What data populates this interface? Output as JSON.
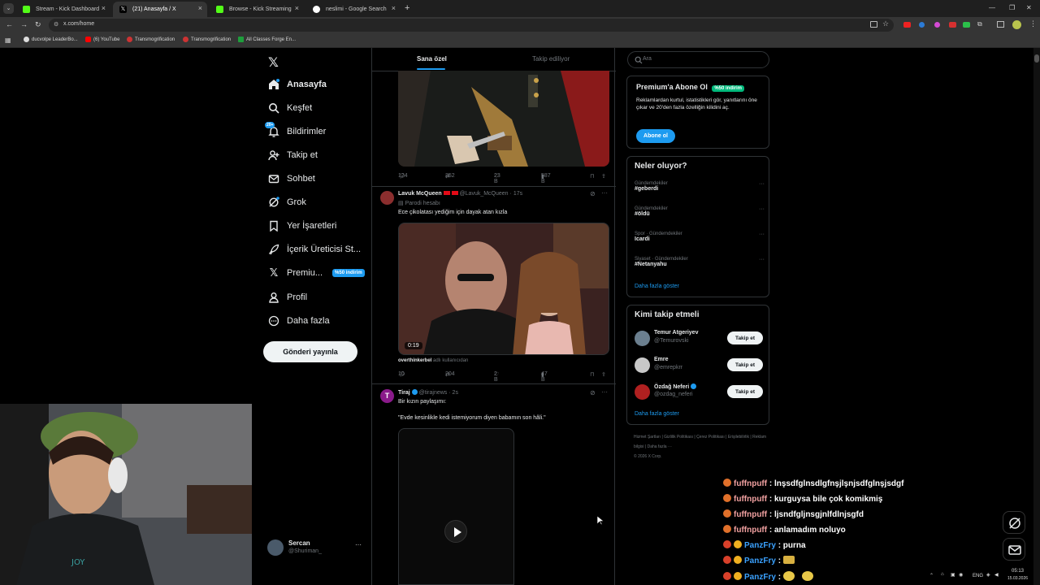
{
  "browser": {
    "tabs": [
      {
        "label": "Stream - Kick Dashboard",
        "active": false,
        "color": "#53fc18"
      },
      {
        "label": "(21) Anasayfa / X",
        "active": true,
        "color": "#ffffff"
      },
      {
        "label": "Browse - Kick Streaming",
        "active": false,
        "color": "#53fc18"
      },
      {
        "label": "neslimi - Google Search",
        "active": false,
        "color": "#4285f4"
      }
    ],
    "url": "x.com/home",
    "bookmarks": [
      "ducvolpe LeaderBo...",
      "(6) YouTube",
      "Transmogrification",
      "Transmogrification",
      "All Classes Forge En..."
    ],
    "window_controls": [
      "—",
      "❐",
      "✕"
    ]
  },
  "sidebar": {
    "items": [
      {
        "label": "Anasayfa",
        "icon": "home-icon"
      },
      {
        "label": "Keşfet",
        "icon": "search-icon"
      },
      {
        "label": "Bildirimler",
        "icon": "bell-icon",
        "badge": "20+"
      },
      {
        "label": "Takip et",
        "icon": "add-user-icon"
      },
      {
        "label": "Sohbet",
        "icon": "mail-icon"
      },
      {
        "label": "Grok",
        "icon": "grok-icon"
      },
      {
        "label": "Yer İşaretleri",
        "icon": "bookmark-icon"
      },
      {
        "label": "İçerik Üreticisi St...",
        "icon": "rocket-icon"
      },
      {
        "label": "Premiu...",
        "icon": "x-icon",
        "badge": "%50 indirim"
      },
      {
        "label": "Profil",
        "icon": "profile-icon"
      },
      {
        "label": "Daha fazla",
        "icon": "more-circle-icon"
      }
    ],
    "post_button": "Gönderi yayınla",
    "account": {
      "name": "Sercan",
      "handle": "@Shuriman_"
    }
  },
  "feed": {
    "tabs": [
      "Sana özel",
      "Takip ediliyor"
    ],
    "post1_actions": {
      "replies": "124",
      "reposts": "352",
      "likes": "23 B",
      "views": "587 B"
    },
    "post2": {
      "author": "Lavuk McQueen",
      "handle": "@Lavuk_McQueen",
      "time": "17s",
      "parody": "Parodi hesabı",
      "text": "Ece çikolatası yediğim için dayak atan kızla",
      "video_time": "0:19",
      "source_user": "overthinkerbel",
      "source_suffix": "adlı kullanıcıdan",
      "replies": "10",
      "reposts": "204",
      "likes": "2 B",
      "views": "47 B"
    },
    "post3": {
      "author": "Tiraj",
      "handle": "@tirajnews",
      "time": "2s",
      "line1": "Bir kızın paylaşımı:",
      "line2": "\"Evde kesinlikle kedi istemiyorum diyen babamın son hâli.\""
    }
  },
  "right": {
    "search_placeholder": "Ara",
    "premium": {
      "title": "Premium'a Abone Ol",
      "badge": "%50 indirim",
      "text": "Reklamlardan kurtul, istatistikleri gör, yanıtlarını öne çıkar ve 20'den fazla özelliğin kilidini aç.",
      "button": "Abone ol"
    },
    "trends": {
      "title": "Neler oluyor?",
      "items": [
        {
          "cat": "Gündemdekiler",
          "tag": "#geberdi"
        },
        {
          "cat": "Gündemdekiler",
          "tag": "#öldü"
        },
        {
          "cat": "Spor · Gündemdekiler",
          "tag": "Icardi"
        },
        {
          "cat": "Siyaset · Gündemdekiler",
          "tag": "#Netanyahu"
        }
      ],
      "more": "Daha fazla göster"
    },
    "follow": {
      "title": "Kimi takip etmeli",
      "items": [
        {
          "name": "Temur Atgeriyev",
          "handle": "@Temurovski",
          "button": "Takip et"
        },
        {
          "name": "Emre",
          "handle": "@emrepkrr",
          "button": "Takip et"
        },
        {
          "name": "Özdağ Neferi",
          "handle": "@ozdag_neferi",
          "button": "Takip et"
        }
      ],
      "more": "Daha fazla göster"
    },
    "footer": [
      "Hizmet Şartları",
      "Gizlilik Politikası",
      "Çerez Politikası",
      "Erişilebilirlik",
      "Reklam bilgisi",
      "Daha fazla ···",
      "© 2026 X Corp."
    ]
  },
  "chat": [
    {
      "user": "fuffnpuff",
      "msg": ": lnşsdfglnsdlgfnşjlşnjsdfglnşjsdgf"
    },
    {
      "user": "fuffnpuff",
      "msg": ": kurguysa bile çok komikmiş"
    },
    {
      "user": "fuffnpuff",
      "msg": ": ljsndfgljnsgjnlfdlnjsgfd"
    },
    {
      "user": "fuffnpuff",
      "msg": ": anlamadım noluyo"
    },
    {
      "user": "PanzFry",
      "msg": ": purna"
    },
    {
      "user": "PanzFry",
      "msg": ":"
    },
    {
      "user": "PanzFry",
      "msg": ":"
    }
  ],
  "taskbar": {
    "lang": "ENG",
    "time": "05:13",
    "date": "15.03.2026"
  }
}
